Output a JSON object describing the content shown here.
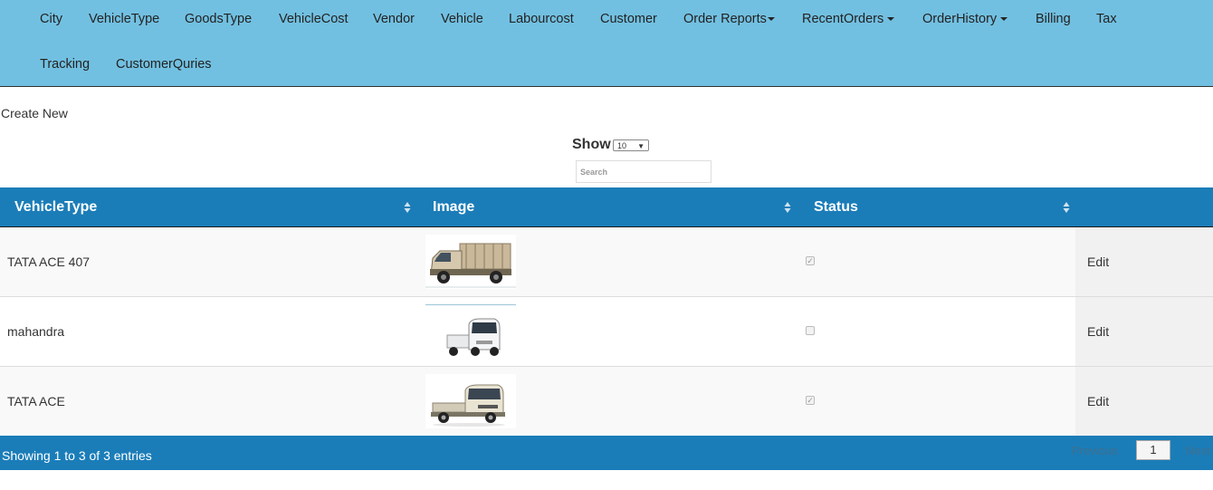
{
  "nav": {
    "row1": [
      "City",
      "VehicleType",
      "GoodsType",
      "VehicleCost",
      "Vendor",
      "Vehicle",
      "Labourcost",
      "Customer",
      "Order Reports",
      "RecentOrders",
      "OrderHistory",
      "Billing",
      "Tax"
    ],
    "row2": [
      "Tracking",
      "CustomerQuries"
    ]
  },
  "controls": {
    "create_new": "Create New",
    "show_label": "Show",
    "show_value": "10",
    "search_placeholder": "Search"
  },
  "table": {
    "headers": [
      "VehicleType",
      "Image",
      "Status"
    ],
    "rows": [
      {
        "vehicle_type": "TATA ACE 407",
        "image": "truck-open-body",
        "status": true,
        "action": "Edit"
      },
      {
        "vehicle_type": "mahandra",
        "image": "mini-truck-white",
        "status": false,
        "action": "Edit"
      },
      {
        "vehicle_type": "TATA ACE",
        "image": "mini-truck-pickup",
        "status": true,
        "action": "Edit"
      }
    ]
  },
  "footer": {
    "info": "Showing 1 to 3 of 3 entries",
    "previous": "Previous",
    "page": "1",
    "next": "Next"
  },
  "colors": {
    "navbar": "#72c0e1",
    "table_header": "#1b7db8",
    "footer": "#1b7db8"
  }
}
